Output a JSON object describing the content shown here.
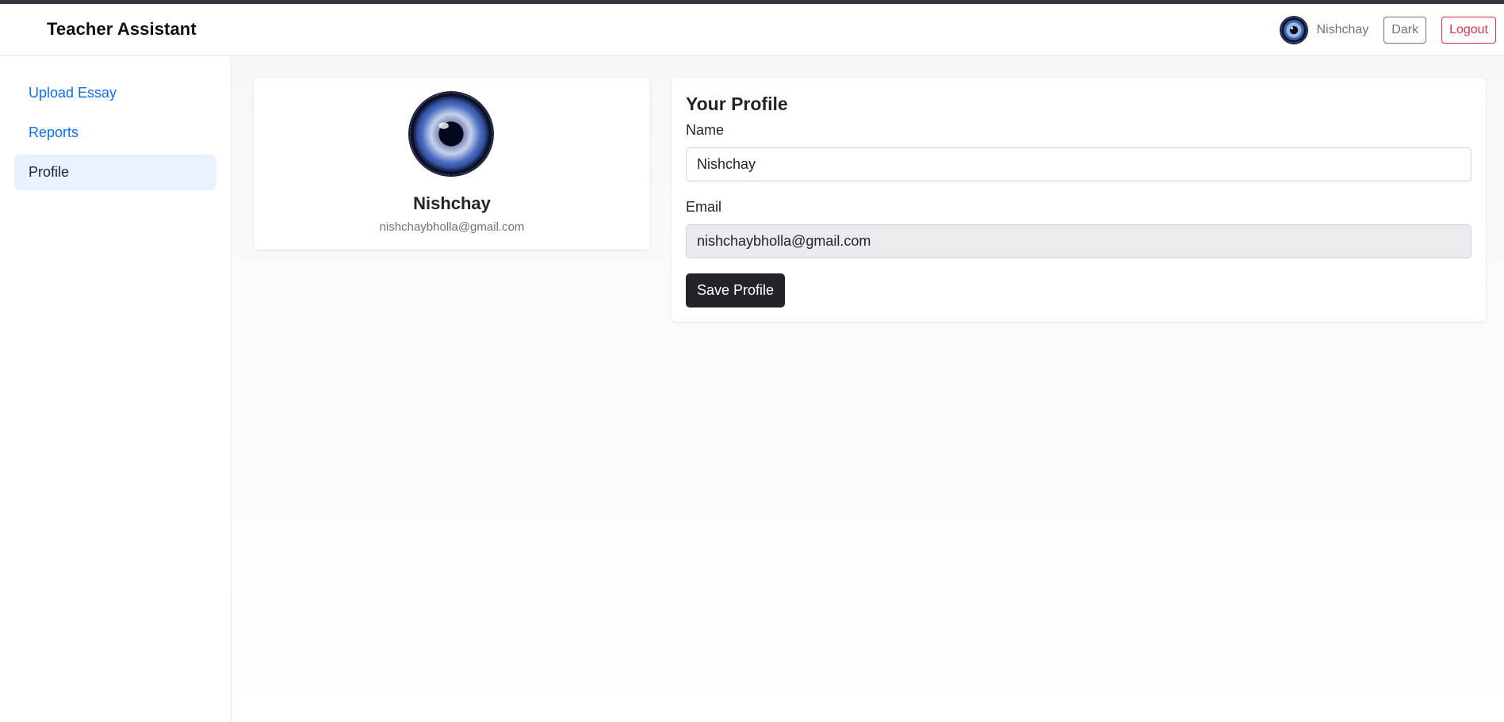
{
  "navbar": {
    "brand": "Teacher Assistant",
    "user_name": "Nishchay",
    "theme_toggle_label": "Dark",
    "logout_label": "Logout"
  },
  "sidebar": {
    "items": [
      {
        "label": "Upload Essay",
        "active": false
      },
      {
        "label": "Reports",
        "active": false
      },
      {
        "label": "Profile",
        "active": true
      }
    ]
  },
  "profile_card": {
    "name": "Nishchay",
    "email": "nishchaybholla@gmail.com"
  },
  "profile_form": {
    "title": "Your Profile",
    "name_label": "Name",
    "name_value": "Nishchay",
    "email_label": "Email",
    "email_value": "nishchaybholla@gmail.com",
    "save_label": "Save Profile"
  },
  "colors": {
    "link": "#0d6efd",
    "active_bg": "#e7f1ff",
    "danger": "#dc3545",
    "dark_button": "#212529"
  },
  "icons": {
    "avatar": "eye-avatar-image"
  }
}
